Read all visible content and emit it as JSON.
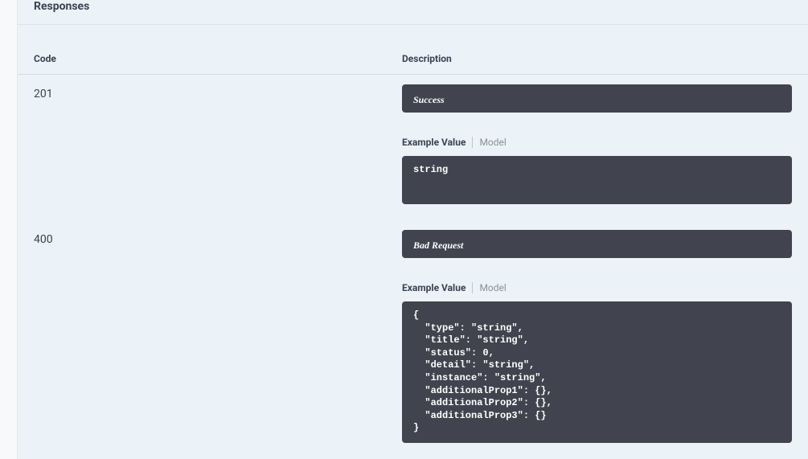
{
  "section": {
    "title": "Responses"
  },
  "headers": {
    "code": "Code",
    "description": "Description"
  },
  "tabs": {
    "exampleValue": "Example Value",
    "model": "Model"
  },
  "responses": [
    {
      "code": "201",
      "status": "Success",
      "body": "string"
    },
    {
      "code": "400",
      "status": "Bad Request",
      "body": "{\n  \"type\": \"string\",\n  \"title\": \"string\",\n  \"status\": 0,\n  \"detail\": \"string\",\n  \"instance\": \"string\",\n  \"additionalProp1\": {},\n  \"additionalProp2\": {},\n  \"additionalProp3\": {}\n}"
    }
  ]
}
